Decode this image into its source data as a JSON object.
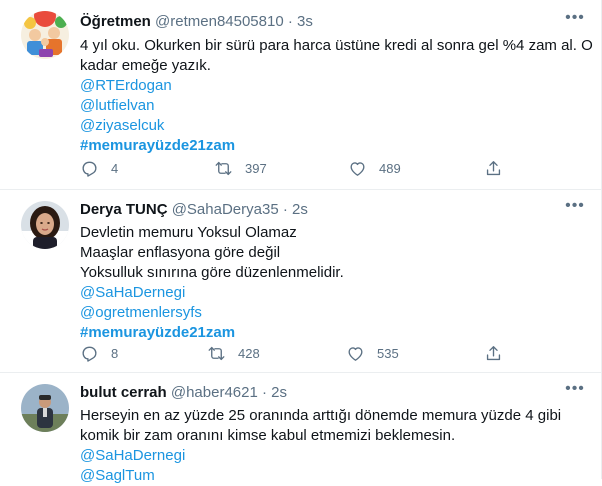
{
  "tweets": [
    {
      "name": "Öğretmen",
      "handle": "@retmen84505810",
      "separator": "·",
      "time": "3s",
      "lines": [
        "4 yıl oku. Okurken bir sürü para harca üstüne kredi al sonra gel %4 zam al. O",
        "kadar emeğe yazık."
      ],
      "mentions": [
        "@RTErdogan",
        "@lutfielvan",
        "@ziyaselcuk"
      ],
      "hashtag": "#memurayüzde21zam",
      "reply_count": "4",
      "retweet_count": "397",
      "like_count": "489"
    },
    {
      "name": "Derya TUNÇ",
      "handle": "@SahaDerya35",
      "separator": "·",
      "time": "2s",
      "lines": [
        "Devletin memuru Yoksul Olamaz",
        "Maaşlar enflasyona göre değil",
        "Yoksulluk sınırına göre düzenlenmelidir."
      ],
      "mentions": [
        "@SaHaDernegi",
        "@ogretmenlersyfs"
      ],
      "hashtag": "#memurayüzde21zam",
      "reply_count": "8",
      "retweet_count": "428",
      "like_count": "535"
    },
    {
      "name": "bulut cerrah",
      "handle": "@haber4621",
      "separator": "·",
      "time": "2s",
      "lines": [
        "Herseyin en az yüzde 25 oranında arttığı dönemde memura yüzde 4 gibi",
        "komik bir zam oranını kimse kabul etmemizi beklemesin."
      ],
      "mentions": [
        "@SaHaDernegi",
        "@SaglTum"
      ]
    }
  ],
  "icons": {
    "reply": "reply-icon",
    "retweet": "retweet-icon",
    "like": "heart-icon",
    "share": "share-icon",
    "more": "more-options-icon"
  },
  "colors": {
    "link": "#1b95e0",
    "secondary": "#5b7083",
    "divider": "#ebeef0"
  }
}
